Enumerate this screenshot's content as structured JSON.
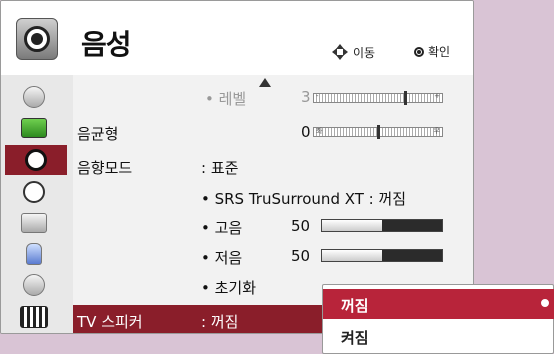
{
  "header": {
    "title": "음성",
    "move_hint": "이동",
    "ok_hint": "확인",
    "icon": "speaker-icon"
  },
  "sidebar": {
    "items": [
      {
        "icon": "satellite-icon"
      },
      {
        "icon": "tv-picture-icon"
      },
      {
        "icon": "speaker-icon",
        "active": true
      },
      {
        "icon": "clock-icon"
      },
      {
        "icon": "toolbox-icon"
      },
      {
        "icon": "lock-icon"
      },
      {
        "icon": "connector-icon"
      },
      {
        "icon": "film-icon"
      }
    ]
  },
  "settings": {
    "level_label": "• 레벨",
    "level_value": "3",
    "level_slider": {
      "min_symbol": "-",
      "max_symbol": "+",
      "position_fraction": 0.72
    },
    "balance_label": "음균형",
    "balance_value": "0",
    "balance_slider": {
      "left_symbol": "좌",
      "right_symbol": "우",
      "position_fraction": 0.5
    },
    "sound_mode_label": "음향모드",
    "sound_mode_value": ": 표준",
    "srs_label": "• SRS TruSurround XT : 꺼짐",
    "treble_label": "• 고음",
    "treble_value": "50",
    "treble_fill_fraction": 0.5,
    "bass_label": "• 저음",
    "bass_value": "50",
    "bass_fill_fraction": 0.5,
    "reset_label": "• 초기화",
    "tv_speaker_label": "TV 스피커",
    "tv_speaker_value": ": 꺼짐"
  },
  "popup": {
    "options": [
      "꺼짐",
      "켜짐"
    ],
    "selected_index": 0
  },
  "colors": {
    "accent": "#8a1e2a",
    "popup_selected": "#b8243a",
    "background": "#d9c4d5"
  }
}
